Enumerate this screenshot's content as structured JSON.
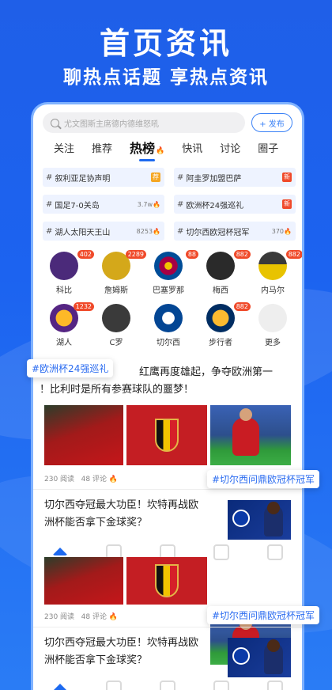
{
  "hero": {
    "title": "首页资讯",
    "subtitle": "聊热点话题 享热点资讯"
  },
  "search": {
    "placeholder": "尤文图斯主席德内德维怒吼"
  },
  "post_button": "+ 发布",
  "tabs": [
    {
      "label": "关注"
    },
    {
      "label": "推荐"
    },
    {
      "label": "热榜"
    },
    {
      "label": "快讯"
    },
    {
      "label": "讨论"
    },
    {
      "label": "圈子"
    }
  ],
  "hot_topics": [
    {
      "title": "叙利亚足协声明",
      "badge": "荐",
      "badge_color": "#f5a623"
    },
    {
      "title": "阿圭罗加盟巴萨",
      "badge": "新",
      "badge_color": "#f04a2a"
    },
    {
      "title": "国足7-0关岛",
      "count": "3.7w"
    },
    {
      "title": "欧洲杯24强巡礼",
      "badge": "新",
      "badge_color": "#f04a2a"
    },
    {
      "title": "湖人太阳天王山",
      "count": "8253"
    },
    {
      "title": "切尔西欧冠杯冠军",
      "count": "370"
    }
  ],
  "avatars_row1": [
    {
      "name": "科比",
      "count": "402",
      "color": "#4b2a7a"
    },
    {
      "name": "詹姆斯",
      "count": "2289",
      "color": "#d4a81a"
    },
    {
      "name": "巴塞罗那",
      "count": "88",
      "color": "#a50044"
    },
    {
      "name": "梅西",
      "count": "882",
      "color": "#2a2a2a"
    },
    {
      "name": "内马尔",
      "count": "882",
      "color": "#e8c300"
    }
  ],
  "avatars_row2": [
    {
      "name": "湖人",
      "count": "1232",
      "color": "#552583"
    },
    {
      "name": "C罗",
      "count": "",
      "color": "#3a3a3a"
    },
    {
      "name": "切尔西",
      "count": "",
      "color": "#034694"
    },
    {
      "name": "步行者",
      "count": "882",
      "color": "#002d62"
    },
    {
      "name": "更多",
      "count": "",
      "color": "#eeeeee"
    }
  ],
  "float_tags": {
    "tag1": "#欧洲杯24强巡礼",
    "tag2": "#切尔西问鼎欧冠杯冠军",
    "tag3": "#切尔西问鼎欧冠杯冠军"
  },
  "article1": {
    "line1": "红鹰再度雄起，争夺欧洲第一",
    "line2": "！比利时是所有参赛球队的噩梦！",
    "reads": "230 阅读",
    "comments": "48 评论"
  },
  "article2": {
    "line1": "切尔西夺冠最大功臣！坎特再战欧",
    "line2": "洲杯能否拿下金球奖？"
  },
  "article3": {
    "reads": "230 阅读",
    "comments": "48 评论"
  },
  "article4": {
    "line1": "切尔西夺冠最大功臣！坎特再战欧",
    "line2": "洲杯能否拿下金球奖？"
  },
  "colors": {
    "accent": "#1d6af0",
    "hot": "#f04a2a",
    "background": "#1f5fe8"
  }
}
